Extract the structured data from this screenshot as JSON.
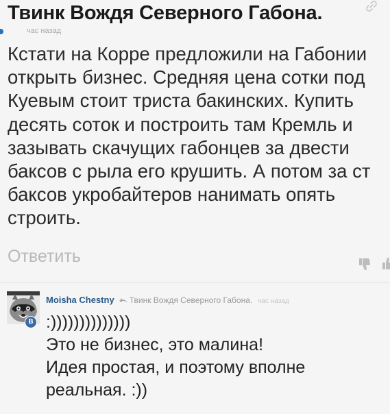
{
  "post": {
    "author": "Твинк Вождя Северного Габона.",
    "time": "час назад",
    "body": "Кстати на Корре предложили на Габонии\nоткрыть бизнес. Средняя цена сотки под\nКуевым стоит триста бакинских. Купить\nдесять соток и построить там Кремль и\nзазывать скачущих габонцев за двести\nбаксов с рыла его крушить. А потом за ст\nбаксов укробайтеров нанимать опять\nстроить.",
    "reply_label": "Ответить"
  },
  "reply": {
    "author": "Moisha Chestny",
    "reply_to": "Твинк Вождя Северного Габона.",
    "time": "час назад",
    "avatar_badge": "B",
    "body": ":))))))))))))))\nЭто не бизнес, это малина!\nИдея простая, и поэтому вполне\nреальная. :))"
  },
  "icons": {
    "top_right": "link-icon",
    "dislike": "thumb-down-icon",
    "like": "thumb-up-icon",
    "reply_arrow": "reply-arrow-icon",
    "online": "online-indicator-icon"
  },
  "colors": {
    "background": "#f5f5f5",
    "author_link": "#2a5a8a",
    "muted_text": "#b8b8b8",
    "badge": "#3b6aa5"
  }
}
